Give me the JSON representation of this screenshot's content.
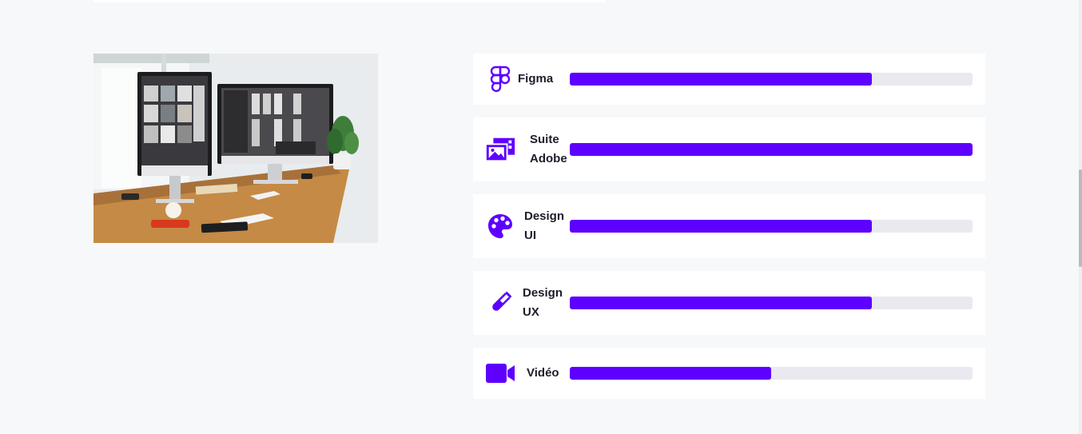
{
  "colors": {
    "accent": "#5e00ff",
    "track": "#e9e9ef",
    "background": "#f7f8fa",
    "card": "#ffffff"
  },
  "photo": {
    "subject": "desk-with-two-monitors"
  },
  "skills": [
    {
      "label": "Figma",
      "icon": "figma-icon",
      "level": 0.75
    },
    {
      "label": "Suite Adobe",
      "icon": "image-gallery-icon",
      "level": 1.0
    },
    {
      "label": "Design UI",
      "icon": "palette-icon",
      "level": 0.75
    },
    {
      "label": "Design UX",
      "icon": "test-tube-icon",
      "level": 0.75
    },
    {
      "label": "Vidéo",
      "icon": "video-camera-icon",
      "level": 0.5
    }
  ]
}
